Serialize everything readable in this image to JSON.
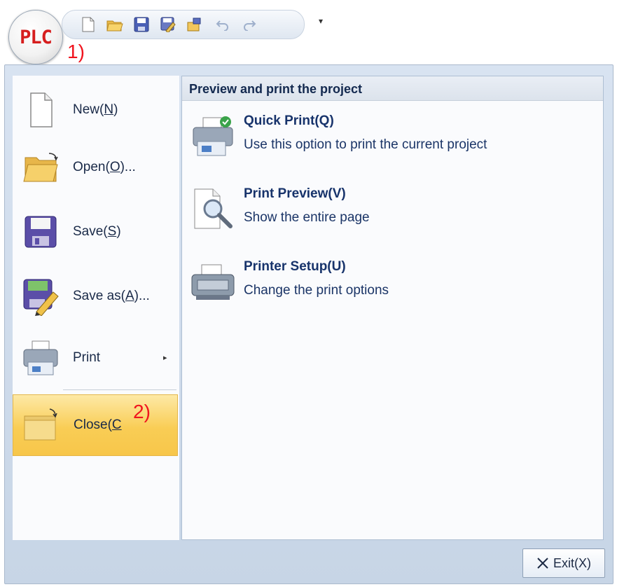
{
  "app": {
    "logo_text": "PLC"
  },
  "annotations": {
    "marker_1": "1)",
    "marker_2": "2)"
  },
  "quick_access": {
    "buttons": [
      "new-doc-icon",
      "open-folder-icon",
      "save-icon",
      "save-as-icon",
      "export-icon",
      "undo-icon",
      "redo-icon"
    ],
    "more_glyph": "▾"
  },
  "menu": {
    "items": [
      {
        "label_main": "New(",
        "label_key": "N",
        "label_end": ")"
      },
      {
        "label_main": "Open(",
        "label_key": "O",
        "label_end": ")..."
      },
      {
        "label_main": "Save(",
        "label_key": "S",
        "label_end": ")"
      },
      {
        "label_main": "Save as(",
        "label_key": "A",
        "label_end": ")..."
      },
      {
        "label_main": "Print",
        "label_key": "",
        "label_end": ""
      },
      {
        "label_main": "Close(",
        "label_key": "C",
        "label_end": ""
      }
    ],
    "submenu_arrow": "▸"
  },
  "print_panel": {
    "header": "Preview and print the project",
    "options": [
      {
        "title": "Quick Print(Q)",
        "desc": "Use this option to print the current project"
      },
      {
        "title": "Print Preview(V)",
        "desc": "Show the entire page"
      },
      {
        "title": "Printer Setup(U)",
        "desc": "Change the print options"
      }
    ]
  },
  "footer": {
    "exit_label": "Exit(X)"
  }
}
